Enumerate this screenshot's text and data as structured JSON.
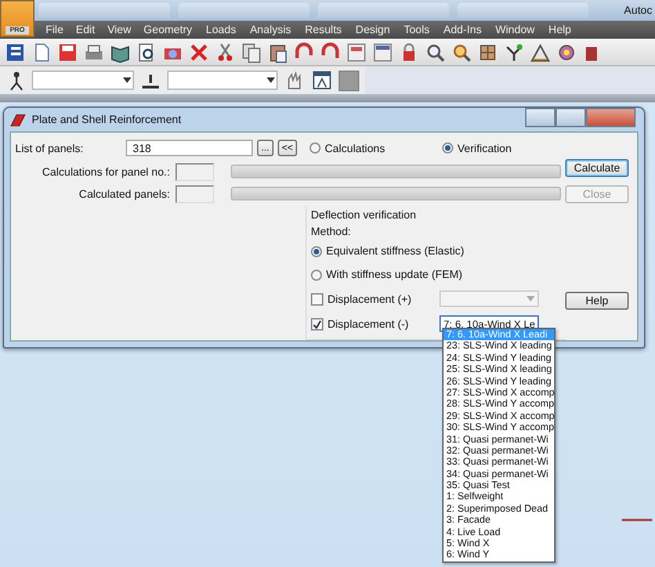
{
  "app": {
    "title": "Autoc",
    "logo_text": "PRO"
  },
  "menu": [
    "File",
    "Edit",
    "View",
    "Geometry",
    "Loads",
    "Analysis",
    "Results",
    "Design",
    "Tools",
    "Add-Ins",
    "Window",
    "Help"
  ],
  "dialog": {
    "title": "Plate and Shell Reinforcement",
    "list_label": "List of panels:",
    "list_value": "318",
    "browse_button": "...",
    "collapse_button": "<<",
    "modes": [
      {
        "label": "Calculations",
        "selected": false
      },
      {
        "label": "Verification",
        "selected": true
      }
    ],
    "panel_no_label": "Calculations for panel no.:",
    "calculated_label": "Calculated panels:",
    "progress": [
      {
        "level": 0
      },
      {
        "level": 0
      }
    ],
    "buttons": [
      {
        "label": "Calculate",
        "disabled": false,
        "focused": true
      },
      {
        "label": "Close",
        "disabled": true,
        "focused": false
      },
      {
        "label": "Help",
        "disabled": false,
        "focused": false
      }
    ],
    "deflection": {
      "title": "Deflection verification",
      "method_label": "Method:",
      "methods": [
        {
          "label": "Equivalent stiffness (Elastic)",
          "selected": true
        },
        {
          "label": "With stiffness update (FEM)",
          "selected": false
        }
      ],
      "displacements": [
        {
          "label": "Displacement (+)",
          "checked": false,
          "combo": {
            "disabled": true
          }
        },
        {
          "label": "Displacement (-)",
          "checked": true,
          "combo": {
            "value": "7: 6. 10a-Wind X Le",
            "disabled": false
          }
        }
      ]
    }
  },
  "dropdown": {
    "items": [
      {
        "label": "7: 6. 10a-Wind X Leadi",
        "selected": true
      },
      {
        "label": "23: SLS-Wind X leading",
        "selected": false
      },
      {
        "label": "24: SLS-Wind Y leading",
        "selected": false
      },
      {
        "label": "25: SLS-Wind X leading",
        "selected": false
      },
      {
        "label": "26: SLS-Wind Y leading",
        "selected": false
      },
      {
        "label": "27: SLS-Wind X accomp",
        "selected": false
      },
      {
        "label": "28: SLS-Wind Y accomp",
        "selected": false
      },
      {
        "label": "29: SLS-Wind X accomp",
        "selected": false
      },
      {
        "label": "30: SLS-Wind Y accomp",
        "selected": false
      },
      {
        "label": "31: Quasi permanet-Wi",
        "selected": false
      },
      {
        "label": "32: Quasi permanet-Wi",
        "selected": false
      },
      {
        "label": "33: Quasi permanet-Wi",
        "selected": false
      },
      {
        "label": "34: Quasi permanet-Wi",
        "selected": false
      },
      {
        "label": "35: Quasi Test",
        "selected": false
      },
      {
        "label": "1: Selfweight",
        "selected": false
      },
      {
        "label": "2: Superimposed Dead",
        "selected": false
      },
      {
        "label": "3: Facade",
        "selected": false
      },
      {
        "label": "4: Live Load",
        "selected": false
      },
      {
        "label": "5: Wind X",
        "selected": false
      },
      {
        "label": "6: Wind Y",
        "selected": false
      }
    ]
  }
}
